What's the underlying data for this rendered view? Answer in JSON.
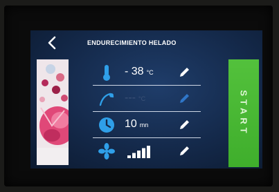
{
  "screen": {
    "title": "ENDURECIMIENTO HELADO"
  },
  "params": [
    {
      "name": "temperature",
      "icon": "thermometer-icon",
      "value": "- 38",
      "unit": "°C",
      "editable": true
    },
    {
      "name": "probe-temperature",
      "icon": "probe-icon",
      "value": "---",
      "unit": "°C",
      "editable": true,
      "disabled": true
    },
    {
      "name": "time",
      "icon": "timer-icon",
      "value": "10",
      "unit": "mn",
      "editable": true
    },
    {
      "name": "fan-speed",
      "icon": "fan-icon",
      "level": 5,
      "max_level": 5,
      "editable": true
    }
  ],
  "actions": {
    "start_label": "START"
  },
  "colors": {
    "accent_blue": "#2f9fe8",
    "start_green": "#4cb936",
    "background": "#14294a"
  }
}
